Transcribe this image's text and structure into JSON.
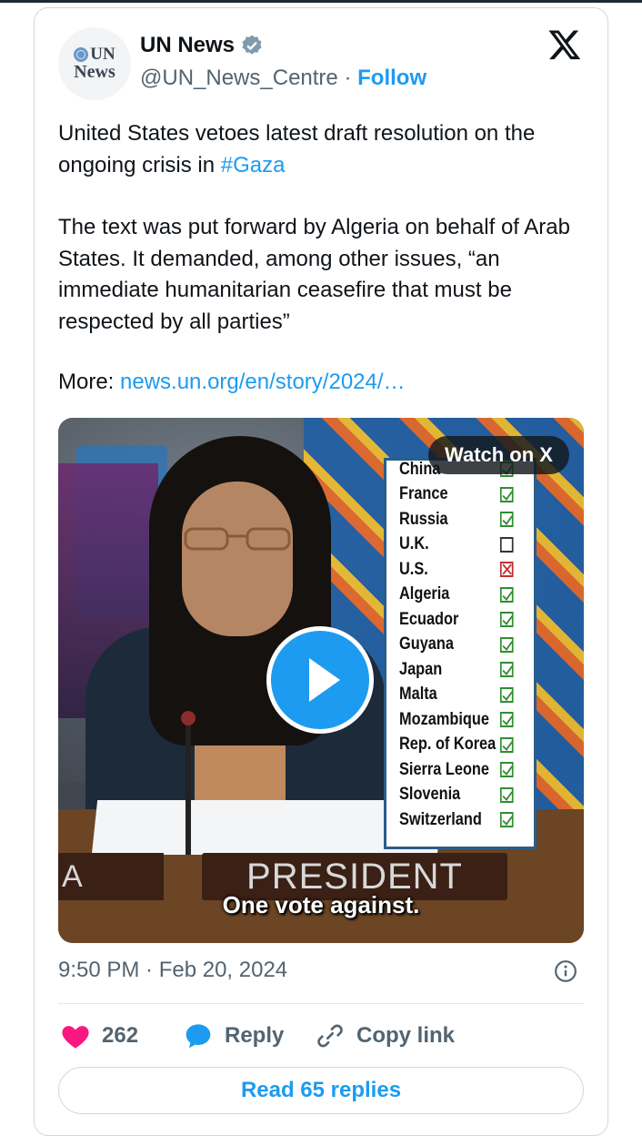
{
  "tweet": {
    "avatar_line1": "UN",
    "avatar_line2": "News",
    "display_name": "UN News",
    "handle": "@UN_News_Centre",
    "separator": "·",
    "follow_label": "Follow",
    "text_line1": "United States vetoes latest draft resolution on the ongoing crisis in ",
    "hashtag": "#Gaza",
    "text_para2": "The text was put forward by Algeria on behalf of Arab States. It demanded, among other issues, “an immediate humanitarian ceasefire that must be respected by all parties”",
    "more_label": "More: ",
    "more_link": "news.un.org/en/story/2024/…",
    "timestamp": "9:50 PM · Feb 20, 2024"
  },
  "media": {
    "watch_label": "Watch on X",
    "caption": "One vote against.",
    "nameplate": "PRESIDENT",
    "nameplate_left": "A",
    "votes": [
      {
        "country": "China",
        "vote": "yes"
      },
      {
        "country": "France",
        "vote": "yes"
      },
      {
        "country": "Russia",
        "vote": "yes"
      },
      {
        "country": "U.K.",
        "vote": "abstain"
      },
      {
        "country": "U.S.",
        "vote": "no"
      },
      {
        "country": "Algeria",
        "vote": "yes"
      },
      {
        "country": "Ecuador",
        "vote": "yes"
      },
      {
        "country": "Guyana",
        "vote": "yes"
      },
      {
        "country": "Japan",
        "vote": "yes"
      },
      {
        "country": "Malta",
        "vote": "yes"
      },
      {
        "country": "Mozambique",
        "vote": "yes"
      },
      {
        "country": "Rep. of Korea",
        "vote": "yes"
      },
      {
        "country": "Sierra Leone",
        "vote": "yes"
      },
      {
        "country": "Slovenia",
        "vote": "yes"
      },
      {
        "country": "Switzerland",
        "vote": "yes"
      }
    ]
  },
  "actions": {
    "like_count": "262",
    "reply_label": "Reply",
    "copy_label": "Copy link",
    "read_replies": "Read 65 replies"
  },
  "colors": {
    "accent": "#1d9bf0",
    "like": "#f91880",
    "muted": "#536471"
  }
}
